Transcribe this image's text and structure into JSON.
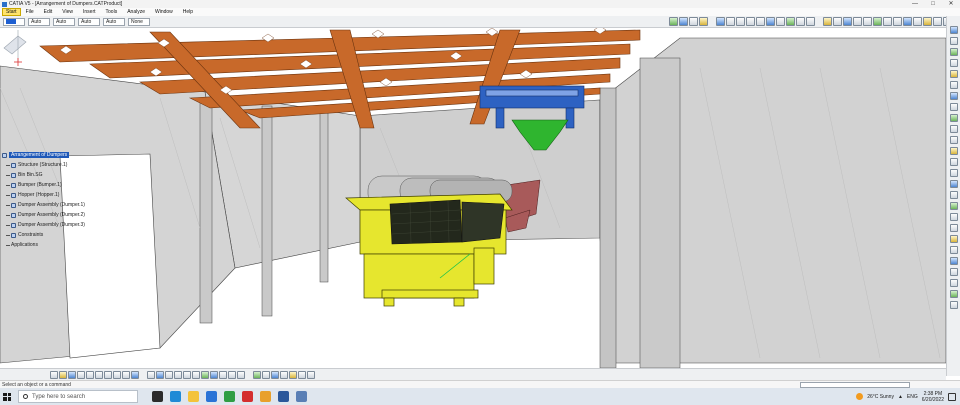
{
  "window": {
    "title": "CATIA V5 - [Arrangement of Dumpers.CATProduct]",
    "controls": [
      "—",
      "□",
      "✕"
    ]
  },
  "menubar": {
    "items": [
      "Start",
      "File",
      "Edit",
      "View",
      "Insert",
      "Tools",
      "Analyze",
      "Window",
      "Help"
    ]
  },
  "toolbar": {
    "selects": [
      "Auto",
      "Auto",
      "Auto",
      "Auto",
      "None"
    ]
  },
  "spec_tree": {
    "root": "Arrangement of Dumpers",
    "children": [
      "Structure (Structure.1)",
      "Bin Bin.SG",
      "Bumper (Bumper.1)",
      "Hopper (Hopper.1)",
      "Dumper Assembly (Dumper.1)",
      "Dumper Assembly (Dumper.2)",
      "Dumper Assembly (Dumper.3)",
      "Constraints",
      "Applications"
    ]
  },
  "status": {
    "text": "Select an object or a command"
  },
  "taskbar": {
    "search_placeholder": "Type here to search",
    "weather": "26°C Sunny",
    "lang": "ENG",
    "time": "2:38 PM",
    "date": "6/20/2022"
  },
  "colors": {
    "beam": "#c8692a",
    "dumper": "#e6e62e",
    "hopper": "#2fb52f",
    "frame_blue": "#2e62c2",
    "wall": "#d4d4d4"
  }
}
